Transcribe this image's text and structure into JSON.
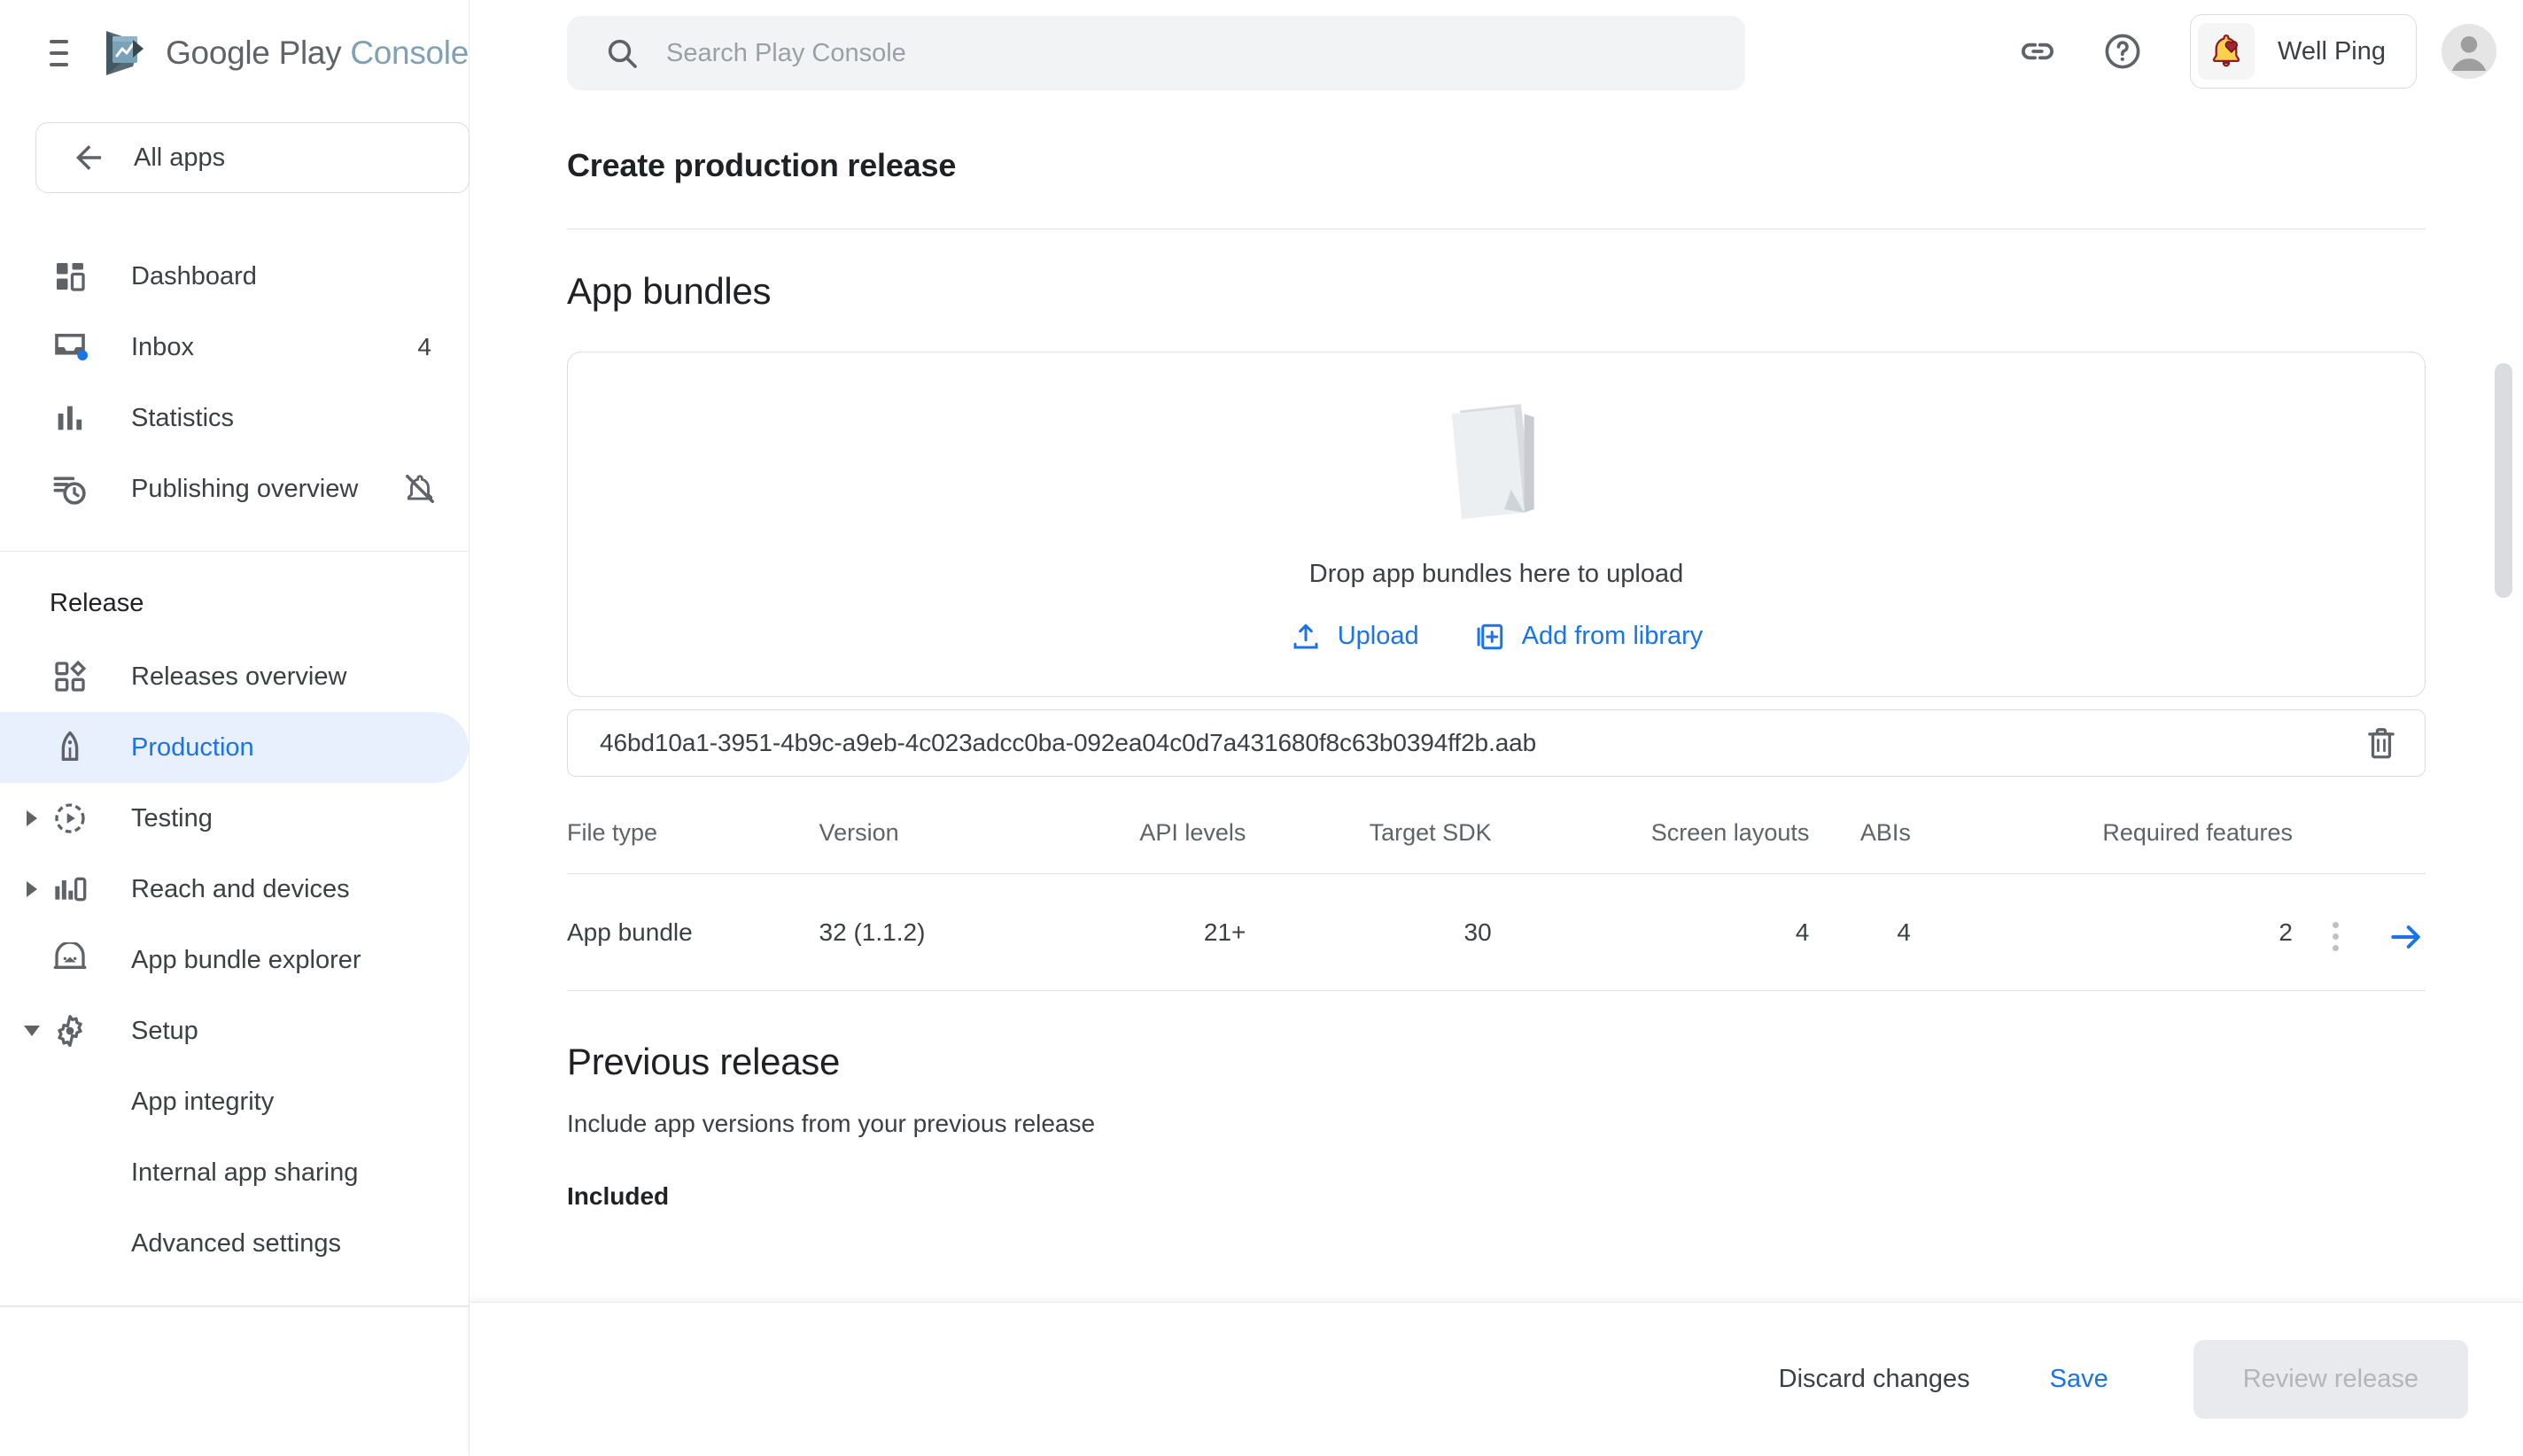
{
  "brand": {
    "google": "Google Play",
    "console": "Console",
    "logo_icon": "google-play-console-logo",
    "menu_icon": "hamburger-menu-icon"
  },
  "sidebar": {
    "all_apps": {
      "label": "All apps",
      "icon": "arrow-left-icon"
    },
    "items": [
      {
        "label": "Dashboard",
        "icon": "dashboard-grid-icon",
        "active": false
      },
      {
        "label": "Inbox",
        "icon": "inbox-icon",
        "badge": "4",
        "active": false
      },
      {
        "label": "Statistics",
        "icon": "bar-chart-icon",
        "active": false
      },
      {
        "label": "Publishing overview",
        "icon": "publishing-clock-icon",
        "trailing_icon": "notifications-off-icon",
        "active": false
      }
    ],
    "section_title": "Release",
    "release_items": [
      {
        "label": "Releases overview",
        "icon": "releases-overview-icon",
        "active": false,
        "caret": "none"
      },
      {
        "label": "Production",
        "icon": "rocket-icon",
        "active": true,
        "caret": "none"
      },
      {
        "label": "Testing",
        "icon": "testing-play-icon",
        "active": false,
        "caret": "right"
      },
      {
        "label": "Reach and devices",
        "icon": "reach-devices-icon",
        "active": false,
        "caret": "right"
      },
      {
        "label": "App bundle explorer",
        "icon": "android-bundle-icon",
        "active": false,
        "caret": "none"
      },
      {
        "label": "Setup",
        "icon": "gear-icon",
        "active": false,
        "caret": "down"
      }
    ],
    "setup_children": [
      {
        "label": "App integrity"
      },
      {
        "label": "Internal app sharing"
      },
      {
        "label": "Advanced settings"
      }
    ]
  },
  "topbar": {
    "search_placeholder": "Search Play Console",
    "search_value": "",
    "search_icon": "search-icon",
    "link_icon": "link-icon",
    "help_icon": "help-circle-icon",
    "app_name": "Well Ping",
    "app_icon": "bell-heart-icon",
    "avatar_icon": "account-avatar-icon"
  },
  "main": {
    "page_title": "Create production release",
    "app_bundles": {
      "heading": "App bundles",
      "dropzone_text": "Drop app bundles here to upload",
      "dropzone_art": "stacked-documents-illustration",
      "upload_label": "Upload",
      "upload_icon": "upload-icon",
      "library_label": "Add from library",
      "library_icon": "add-from-library-icon",
      "file_name": "46bd10a1-3951-4b9c-a9eb-4c023adcc0ba-092ea04c0d7a431680f8c63b0394ff2b.aab",
      "delete_icon": "trash-icon",
      "table": {
        "columns": [
          "File type",
          "Version",
          "API levels",
          "Target SDK",
          "Screen layouts",
          "ABIs",
          "Required features"
        ],
        "rows": [
          {
            "file_type": "App bundle",
            "version": "32 (1.1.2)",
            "api_levels": "21+",
            "target_sdk": "30",
            "screen_layouts": "4",
            "abis": "4",
            "required_features": "2",
            "menu_icon": "kebab-menu-icon",
            "detail_icon": "arrow-right-icon"
          }
        ]
      }
    },
    "previous_release": {
      "heading": "Previous release",
      "description": "Include app versions from your previous release",
      "included_label": "Included"
    }
  },
  "bottombar": {
    "discard_label": "Discard changes",
    "save_label": "Save",
    "review_label": "Review release"
  },
  "colors": {
    "accent_blue": "#1a73e8",
    "active_pill": "#e8f0fe",
    "text_primary": "#202124",
    "text_secondary": "#5f6368",
    "divider": "#e8eaed"
  }
}
